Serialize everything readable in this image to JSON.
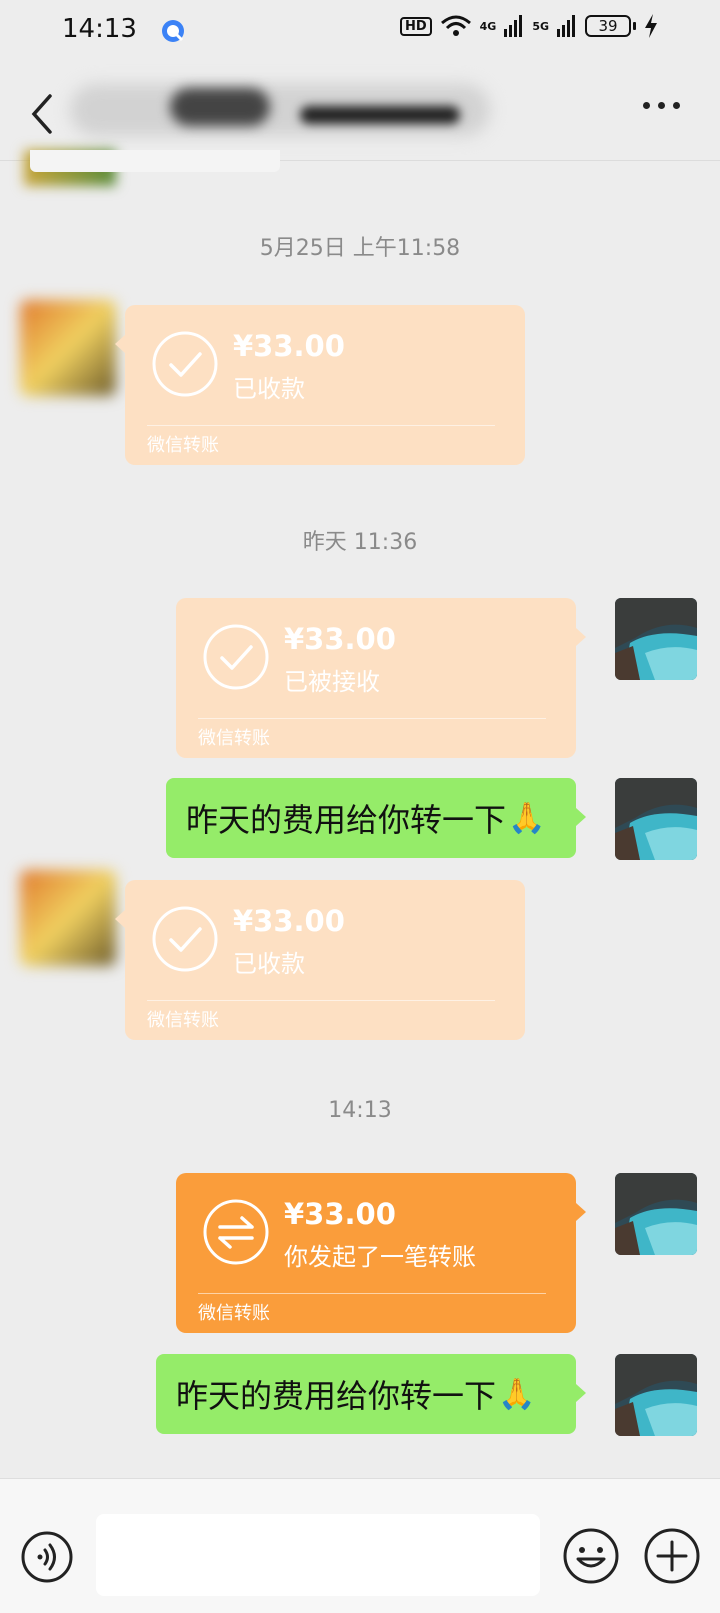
{
  "status_bar": {
    "time": "14:13",
    "hd": "HD",
    "network_4g": "4G",
    "network_5g": "5G",
    "battery": "39"
  },
  "messages": {
    "ts1": "5月25日 上午11:58",
    "ts2": "昨天 11:36",
    "ts3": "14:13",
    "transfer1": {
      "amount": "¥33.00",
      "status": "已收款",
      "label": "微信转账"
    },
    "transfer2": {
      "amount": "¥33.00",
      "status": "已被接收",
      "label": "微信转账"
    },
    "text1": "昨天的费用给你转一下",
    "transfer3": {
      "amount": "¥33.00",
      "status": "已收款",
      "label": "微信转账"
    },
    "transfer4": {
      "amount": "¥33.00",
      "status": "你发起了一笔转账",
      "label": "微信转账"
    },
    "text2": "昨天的费用给你转一下",
    "emoji": "🙏"
  },
  "colors": {
    "faded_transfer": "#fde0c3",
    "active_transfer": "#fa9d3b",
    "my_bubble": "#95ec69"
  },
  "icons": [
    "back-icon",
    "more-icon",
    "check-icon",
    "transfer-arrows-icon",
    "voice-icon",
    "emoji-icon",
    "plus-icon"
  ]
}
